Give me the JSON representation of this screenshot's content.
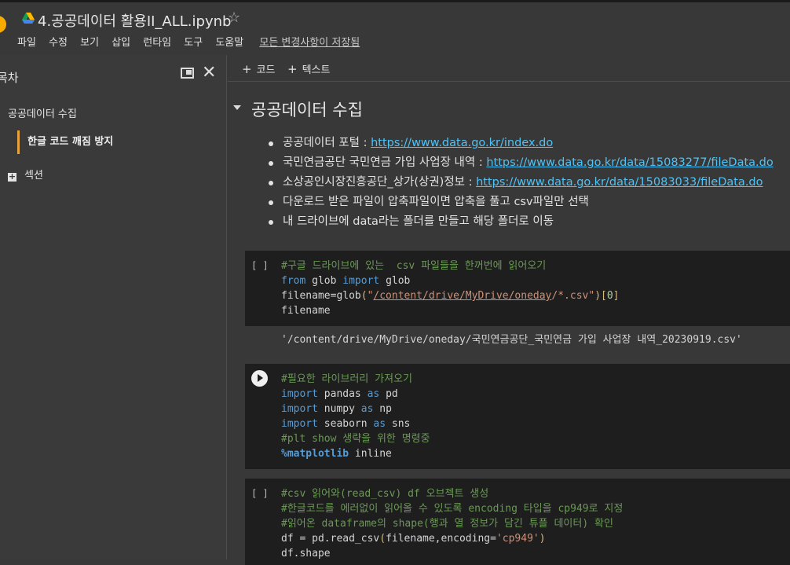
{
  "header": {
    "notebook_title": "4.공공데이터 활용II_ALL.ipynb",
    "menu": [
      "파일",
      "수정",
      "보기",
      "삽입",
      "런타임",
      "도구",
      "도움말"
    ],
    "save_status": "모든 변경사항이 저장됨",
    "star_glyph": "☆"
  },
  "sidebar": {
    "title": "목차",
    "close_glyph": "✕",
    "items": [
      {
        "label": "공공데이터 수집"
      },
      {
        "label": "한글 코드 깨짐 방지"
      }
    ],
    "section_label": "섹션"
  },
  "toolbar": {
    "add_code": "코드",
    "add_text": "텍스트",
    "plus_glyph": "+"
  },
  "section": {
    "heading": "공공데이터 수집"
  },
  "bullets": {
    "b1": {
      "text": "공공데이터 포털 : ",
      "link": "https://www.data.go.kr/index.do"
    },
    "b2": {
      "text": "국민연금공단 국민연금 가입 사업장 내역 : ",
      "link": "https://www.data.go.kr/data/15083277/fileData.do"
    },
    "b3": {
      "text": "소상공인시장진흥공단_상가(상권)정보 : ",
      "link": "https://www.data.go.kr/data/15083033/fileData.do"
    },
    "b4": {
      "text": "다운로드 받은 파일이 압축파일이면 압축을 풀고 csv파일만 선택"
    },
    "b5": {
      "text": "내 드라이브에 data라는 폴더를 만들고 해당 폴더로 이동"
    }
  },
  "cells": {
    "gutter_idle": "[ ]",
    "c1": {
      "comment": "#구글 드라이브에 있는  csv 파일들을 한꺼번에 읽어오기",
      "kw_from": "from",
      "mod": " glob ",
      "kw_import": "import",
      "name": " glob",
      "l3_pre": "filename=glob",
      "l3_open": "(",
      "l3_q1": "\"",
      "l3_path": "/content/drive/MyDrive/oneday",
      "l3_rest": "/*.csv\"",
      "l3_close": ")",
      "l3_idx_open": "[",
      "l3_idx": "0",
      "l3_idx_close": "]",
      "l4": "filename",
      "output": "'/content/drive/MyDrive/oneday/국민연금공단_국민연금 가입 사업장 내역_20230919.csv'"
    },
    "c2": {
      "comment1": "#필요한 라이브러리 가져오기",
      "kw_import": "import",
      "kw_as": "as",
      "l2_mod": " pandas ",
      "l2_alias": " pd",
      "l3_mod": " numpy ",
      "l3_alias": " np",
      "l4_mod": " seaborn ",
      "l4_alias": " sns",
      "comment2": "#plt show 생략을 위한 명령중",
      "magic": "%matplotlib",
      "magic_arg": " inline"
    },
    "c3": {
      "comment1": "#csv 읽어와(read_csv) df 오브젝트 생성",
      "comment2": "#한글코드를 에러없이 읽어올 수 있도록 encoding 타입을 cp949로 지정",
      "comment3": "#읽어온 dataframe의 shape(행과 열 정보가 담긴 튜플 데이터) 확인",
      "l4_pre": "df = pd.read_csv",
      "l4_open": "(",
      "l4_mid": "filename,encoding=",
      "l4_str": "'cp949'",
      "l4_close": ")",
      "l5": "df.shape"
    }
  }
}
